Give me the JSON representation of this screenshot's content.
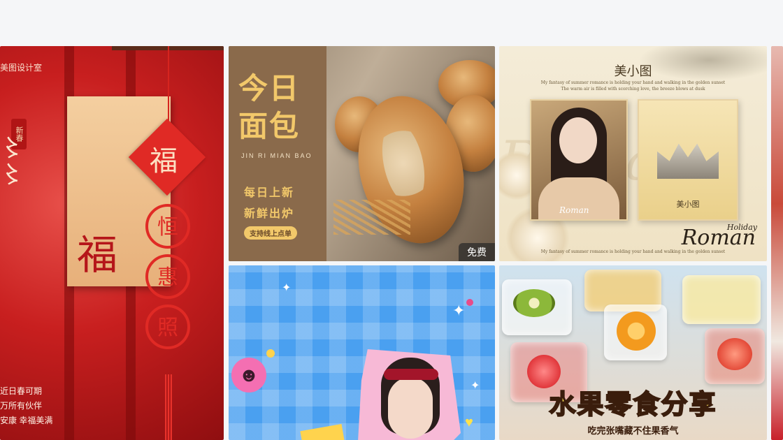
{
  "colors": {
    "page_bg": "#f5f6f8",
    "newyear_red": "#c81f1f",
    "bread_gold": "#f2c86a",
    "blue_bg": "#4aa0f0",
    "fruit_title": "#ffe65a"
  },
  "cards": {
    "newyear": {
      "brand": "美图设计室",
      "tag": "新春",
      "fu": "福",
      "diamond_char": "福",
      "coins": [
        "恒",
        "惠",
        "照"
      ],
      "lines": [
        "近日春可期",
        "万所有伙伴",
        "安康 幸福美满"
      ]
    },
    "bread": {
      "title": "今日面包",
      "pinyin": "JIN RI MIAN BAO",
      "slogan_1": "每日上新",
      "slogan_2": "新鲜出炉",
      "pill": "支持线上点单",
      "badge": "免费"
    },
    "roman": {
      "title": "美小图",
      "fine_1": "My fantasy of summer romance is holding your hand and walking in the golden sunset",
      "fine_2": "The warm air is filled with scorching love, the breeze blows at dusk",
      "photo_sig": "Roman",
      "card_label": "美小图",
      "signature": "Roman",
      "holiday": "Holiday"
    },
    "blue": {
      "smiley": "☻"
    },
    "fruit": {
      "headline": "水果零食分享",
      "subline": "吃完张嘴藏不住果香气"
    }
  }
}
